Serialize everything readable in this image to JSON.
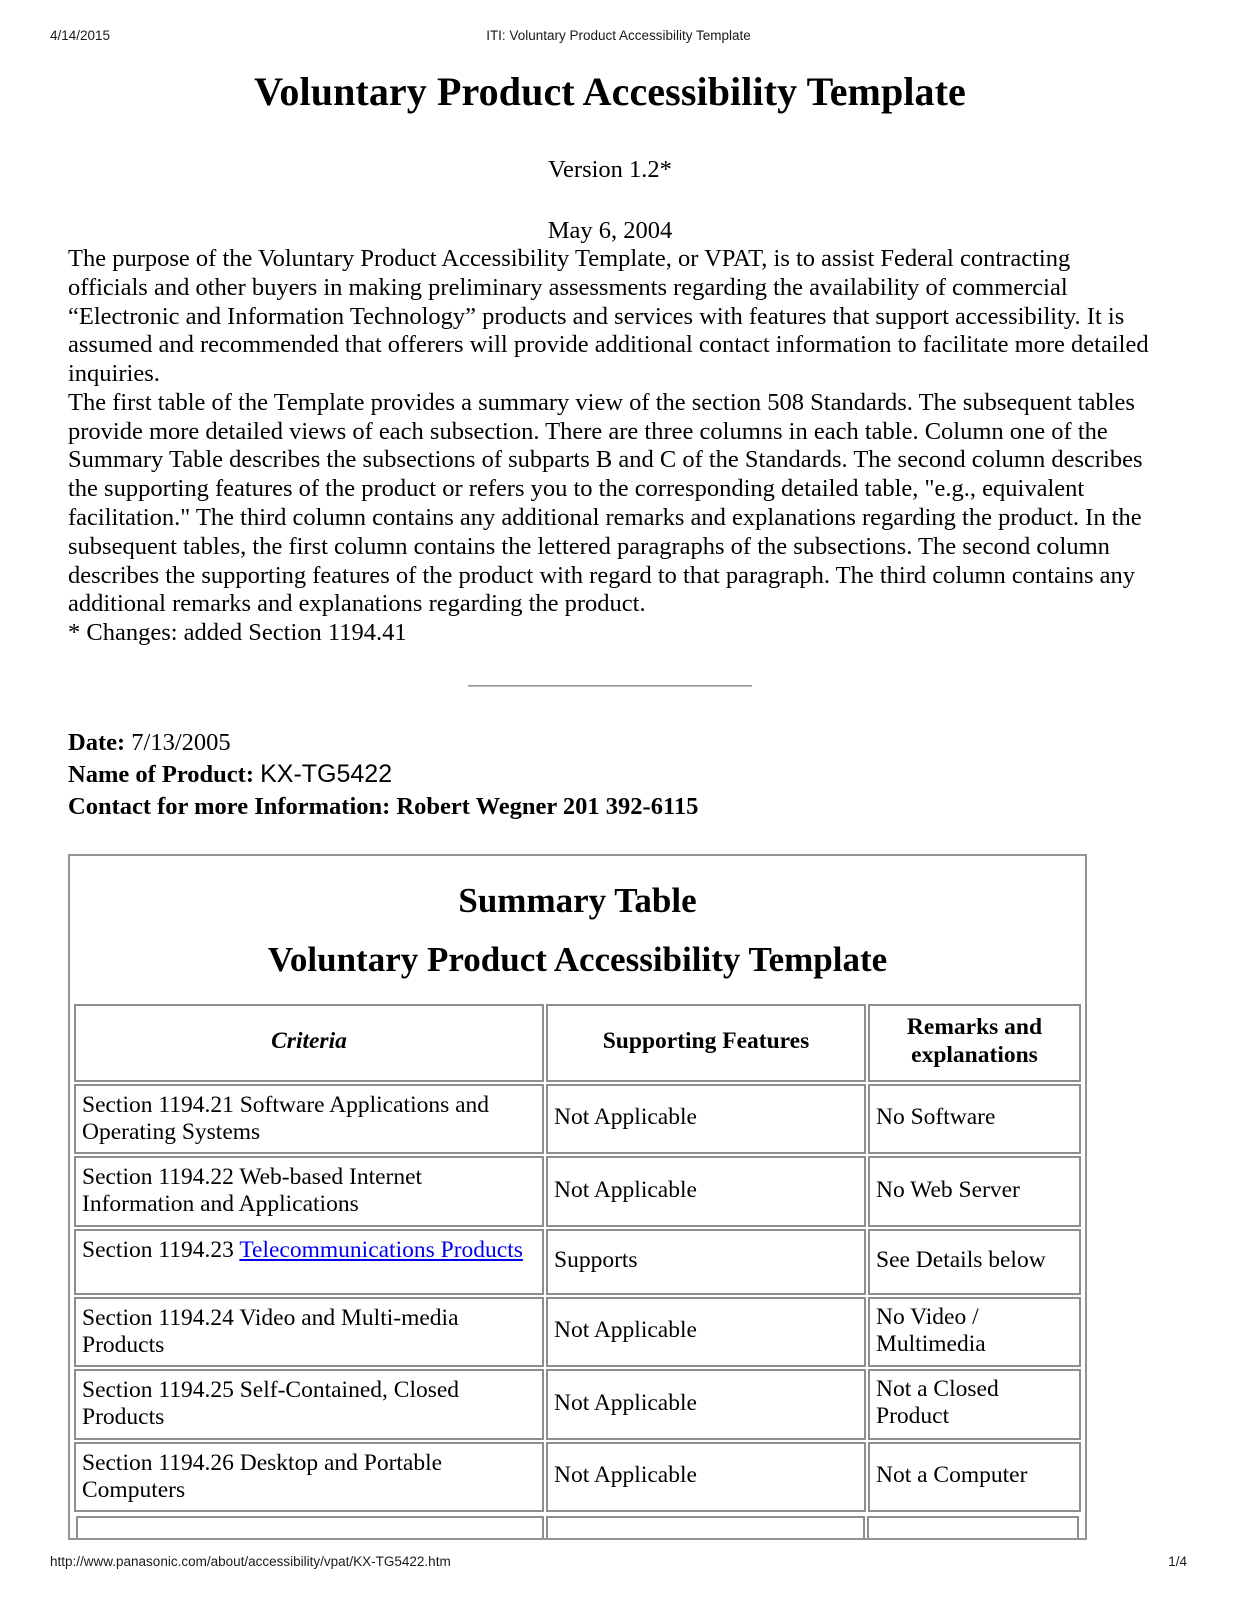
{
  "page_header": {
    "date": "4/14/2015",
    "title": "ITI: Voluntary Product Accessibility Template"
  },
  "page_footer": {
    "url": "http://www.panasonic.com/about/accessibility/vpat/KX-TG5422.htm",
    "page_number": "1/4"
  },
  "document": {
    "title": "Voluntary Product Accessibility Template",
    "version": "Version 1.2*",
    "date": "May 6, 2004",
    "paragraph_1": "The purpose of the Voluntary Product Accessibility Template, or VPAT, is to assist Federal contracting officials and other buyers in making preliminary assessments regarding the availability of commercial “Electronic and Information Technology” products and services with features that support accessibility. It is assumed and recommended that offerers will provide additional contact information to facilitate more detailed inquiries.",
    "paragraph_2": "The first table of the Template provides a summary view of the section 508 Standards. The subsequent tables provide more detailed views of each subsection. There are three columns in each table. Column one of the Summary Table describes the subsections of subparts B and C of the Standards. The second column describes the supporting features of the product or refers you to the corresponding detailed table, \"e.g., equivalent facilitation.\" The third column contains any additional remarks and explanations regarding the product. In the subsequent tables, the first column contains the lettered paragraphs of the subsections. The second column describes the supporting features of the product with regard to that paragraph. The third column contains any additional remarks and explanations regarding the product.",
    "changes_note": "* Changes: added Section 1194.41"
  },
  "identity": {
    "date_label": "Date:",
    "date_value": "7/13/2005",
    "product_label": "Name of Product:",
    "product_value": "KX-TG5422",
    "contact_line": "Contact for more Information: Robert Wegner 201 392-6115"
  },
  "summary_table": {
    "heading_line_1": "Summary Table",
    "heading_line_2": "Voluntary Product Accessibility Template",
    "columns": [
      "Criteria",
      "Supporting Features",
      "Remarks and explanations"
    ],
    "rows": [
      {
        "criteria": "Section 1194.21 Software Applications and Operating Systems",
        "criteria_prefix": "Section 1194.21 Software Applications and Operating Systems",
        "link_text": "",
        "criteria_suffix": "",
        "supporting_features": "Not Applicable",
        "remarks": "No Software"
      },
      {
        "criteria": "Section 1194.22 Web-based Internet Information and Applications",
        "criteria_prefix": "Section 1194.22 Web-based Internet Information and Applications",
        "link_text": "",
        "criteria_suffix": "",
        "supporting_features": "Not Applicable",
        "remarks": "No Web Server"
      },
      {
        "criteria": "Section 1194.23 Telecommunications Products",
        "criteria_prefix": "Section 1194.23 ",
        "link_text": "Telecommunications Products",
        "criteria_suffix": "",
        "supporting_features": "Supports",
        "remarks": "See Details below"
      },
      {
        "criteria": "Section 1194.24 Video and Multi-media Products",
        "criteria_prefix": "Section 1194.24 Video and Multi-media Products",
        "link_text": "",
        "criteria_suffix": "",
        "supporting_features": "Not Applicable",
        "remarks": "No Video / Multimedia"
      },
      {
        "criteria": "Section 1194.25 Self-Contained, Closed Products",
        "criteria_prefix": "Section 1194.25 Self-Contained, Closed Products",
        "link_text": "",
        "criteria_suffix": "",
        "supporting_features": "Not Applicable",
        "remarks": "Not a Closed Product"
      },
      {
        "criteria": "Section 1194.26 Desktop and Portable Computers",
        "criteria_prefix": "Section 1194.26 Desktop and Portable Computers",
        "link_text": "",
        "criteria_suffix": "",
        "supporting_features": "Not Applicable",
        "remarks": "Not a Computer"
      }
    ]
  },
  "colors": {
    "link": "#0000ee",
    "table_border": "#8d8d8d",
    "box_border": "#949494",
    "rule": "#b9b9b9",
    "text": "#000000"
  }
}
